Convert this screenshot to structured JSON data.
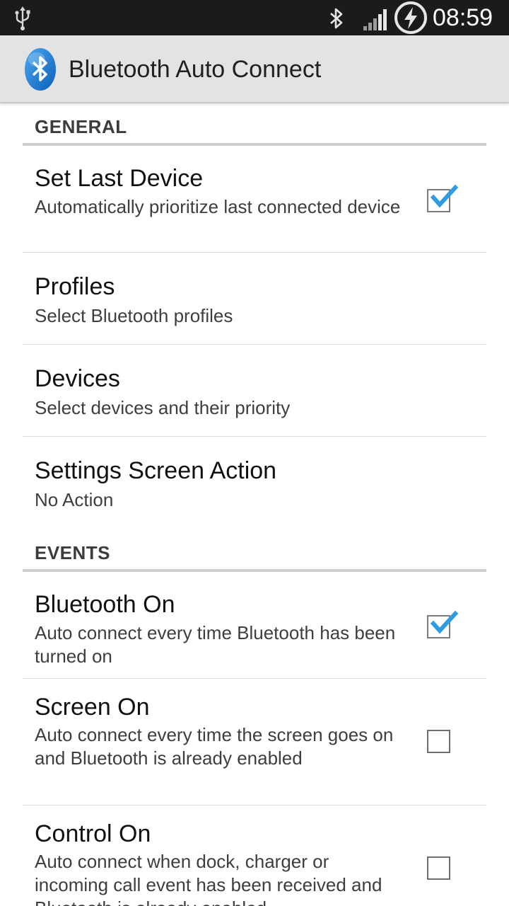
{
  "status_bar": {
    "time": "08:59",
    "icons": [
      "usb-icon",
      "bluetooth-icon",
      "signal-icon",
      "battery-charging-icon"
    ]
  },
  "action_bar": {
    "icon": "bluetooth-app-icon",
    "title": "Bluetooth Auto Connect"
  },
  "colors": {
    "accent": "#2f9be0",
    "status_bar_bg": "#1b1b1b",
    "action_bar_bg": "#e3e3e3"
  },
  "sections": [
    {
      "header": "GENERAL",
      "items": [
        {
          "title": "Set Last Device",
          "summary": "Automatically prioritize last connected device",
          "checkbox": true,
          "checked": true
        },
        {
          "title": "Profiles",
          "summary": "Select Bluetooth profiles",
          "checkbox": false
        },
        {
          "title": "Devices",
          "summary": "Select devices and their priority",
          "checkbox": false
        },
        {
          "title": "Settings Screen Action",
          "summary": "No Action",
          "checkbox": false
        }
      ]
    },
    {
      "header": "EVENTS",
      "items": [
        {
          "title": "Bluetooth On",
          "summary": "Auto connect every time Bluetooth has been turned on",
          "checkbox": true,
          "checked": true
        },
        {
          "title": "Screen On",
          "summary": "Auto connect every time the screen goes on and Bluetooth is already enabled",
          "checkbox": true,
          "checked": false
        },
        {
          "title": "Control On",
          "summary": "Auto connect when dock, charger or incoming call event has been received and Bluetooth is already enabled",
          "checkbox": true,
          "checked": false
        }
      ]
    }
  ]
}
